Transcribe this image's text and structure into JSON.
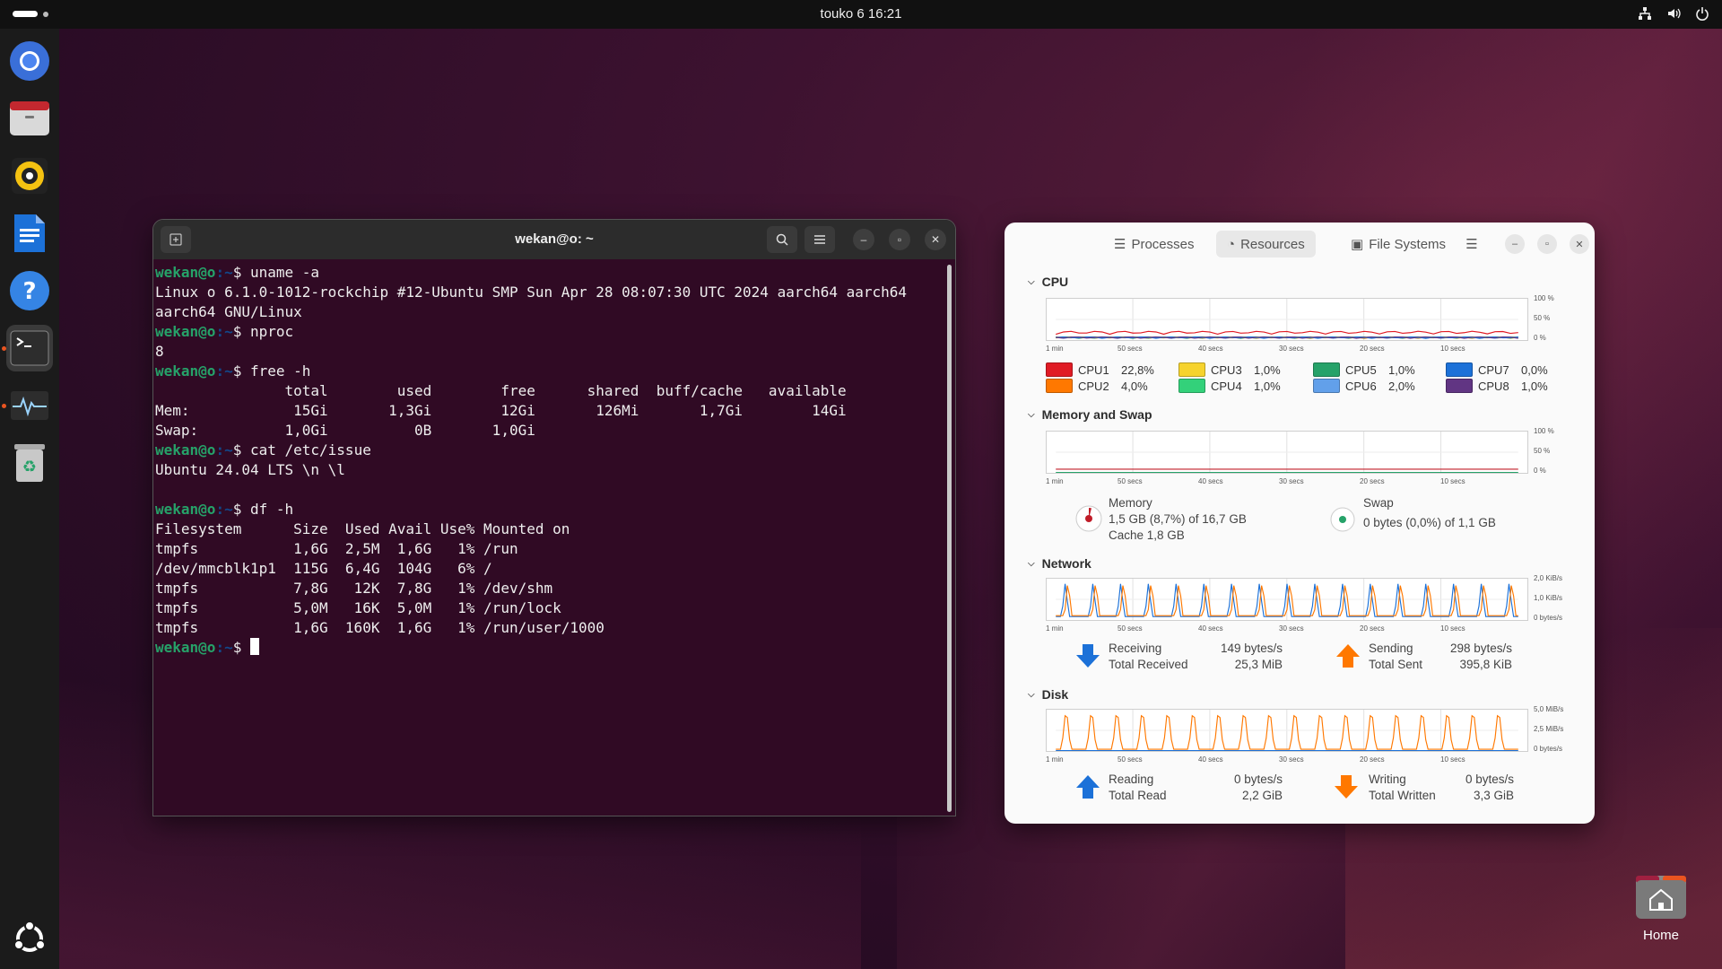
{
  "topbar": {
    "clock": "touko 6  16:21"
  },
  "dock": {
    "items": [
      {
        "name": "chromium"
      },
      {
        "name": "files"
      },
      {
        "name": "rhythmbox"
      },
      {
        "name": "writer"
      },
      {
        "name": "help"
      },
      {
        "name": "terminal"
      },
      {
        "name": "system-monitor"
      },
      {
        "name": "trash"
      }
    ]
  },
  "terminal": {
    "title": "wekan@o: ~",
    "prompt_user": "wekan@o",
    "prompt_path": ":~",
    "prompt_symbol": "$ ",
    "lines": [
      {
        "type": "cmd",
        "text": "uname -a"
      },
      {
        "type": "out",
        "text": "Linux o 6.1.0-1012-rockchip #12-Ubuntu SMP Sun Apr 28 08:07:30 UTC 2024 aarch64 aarch64"
      },
      {
        "type": "out",
        "text": "aarch64 GNU/Linux"
      },
      {
        "type": "cmd",
        "text": "nproc"
      },
      {
        "type": "out",
        "text": "8"
      },
      {
        "type": "cmd",
        "text": "free -h"
      },
      {
        "type": "out",
        "text": "               total        used        free      shared  buff/cache   available"
      },
      {
        "type": "out",
        "text": "Mem:            15Gi       1,3Gi        12Gi       126Mi       1,7Gi        14Gi"
      },
      {
        "type": "out",
        "text": "Swap:          1,0Gi          0B       1,0Gi"
      },
      {
        "type": "cmd",
        "text": "cat /etc/issue"
      },
      {
        "type": "out",
        "text": "Ubuntu 24.04 LTS \\n \\l"
      },
      {
        "type": "out",
        "text": ""
      },
      {
        "type": "cmd",
        "text": "df -h"
      },
      {
        "type": "out",
        "text": "Filesystem      Size  Used Avail Use% Mounted on"
      },
      {
        "type": "out",
        "text": "tmpfs           1,6G  2,5M  1,6G   1% /run"
      },
      {
        "type": "out",
        "text": "/dev/mmcblk1p1  115G  6,4G  104G   6% /"
      },
      {
        "type": "out",
        "text": "tmpfs           7,8G   12K  7,8G   1% /dev/shm"
      },
      {
        "type": "out",
        "text": "tmpfs           5,0M   16K  5,0M   1% /run/lock"
      },
      {
        "type": "out",
        "text": "tmpfs           1,6G  160K  1,6G   1% /run/user/1000"
      },
      {
        "type": "prompt",
        "text": ""
      }
    ]
  },
  "sysmon": {
    "tabs": [
      {
        "label": "Processes",
        "icon": "list-icon",
        "active": false
      },
      {
        "label": "Resources",
        "icon": "gauge-icon",
        "active": true
      },
      {
        "label": "File Systems",
        "icon": "disk-icon",
        "active": false
      }
    ],
    "time_labels": [
      "1 min",
      "50 secs",
      "40 secs",
      "30 secs",
      "20 secs",
      "10 secs"
    ],
    "cpu": {
      "title": "CPU",
      "y_labels": [
        "100 %",
        "50 %",
        "0 %"
      ],
      "cores": [
        {
          "label": "CPU1",
          "value": "22,8%",
          "color": "#e01b24"
        },
        {
          "label": "CPU2",
          "value": "4,0%",
          "color": "#ff7800"
        },
        {
          "label": "CPU3",
          "value": "1,0%",
          "color": "#f6d32d"
        },
        {
          "label": "CPU4",
          "value": "1,0%",
          "color": "#33d17a"
        },
        {
          "label": "CPU5",
          "value": "1,0%",
          "color": "#26a269"
        },
        {
          "label": "CPU6",
          "value": "2,0%",
          "color": "#62a0ea"
        },
        {
          "label": "CPU7",
          "value": "0,0%",
          "color": "#1c71d8"
        },
        {
          "label": "CPU8",
          "value": "1,0%",
          "color": "#613583"
        }
      ]
    },
    "memory": {
      "title": "Memory and Swap",
      "y_labels": [
        "100 %",
        "50 %",
        "0 %"
      ],
      "memory_label": "Memory",
      "memory_value": "1,5 GB (8,7%) of 16,7 GB",
      "cache_value": "Cache 1,8 GB",
      "swap_label": "Swap",
      "swap_value": "0 bytes (0,0%) of 1,1 GB"
    },
    "network": {
      "title": "Network",
      "y_labels": [
        "2,0 KiB/s",
        "1,0 KiB/s",
        "0 bytes/s"
      ],
      "receiving_label": "Receiving",
      "receiving_value": "149 bytes/s",
      "total_received_label": "Total Received",
      "total_received_value": "25,3 MiB",
      "sending_label": "Sending",
      "sending_value": "298 bytes/s",
      "total_sent_label": "Total Sent",
      "total_sent_value": "395,8 KiB"
    },
    "disk": {
      "title": "Disk",
      "y_labels": [
        "5,0 MiB/s",
        "2,5 MiB/s",
        "0 bytes/s"
      ],
      "reading_label": "Reading",
      "reading_value": "0 bytes/s",
      "total_read_label": "Total Read",
      "total_read_value": "2,2 GiB",
      "writing_label": "Writing",
      "writing_value": "0 bytes/s",
      "total_written_label": "Total Written",
      "total_written_value": "3,3 GiB"
    }
  },
  "desktop": {
    "home_label": "Home"
  }
}
